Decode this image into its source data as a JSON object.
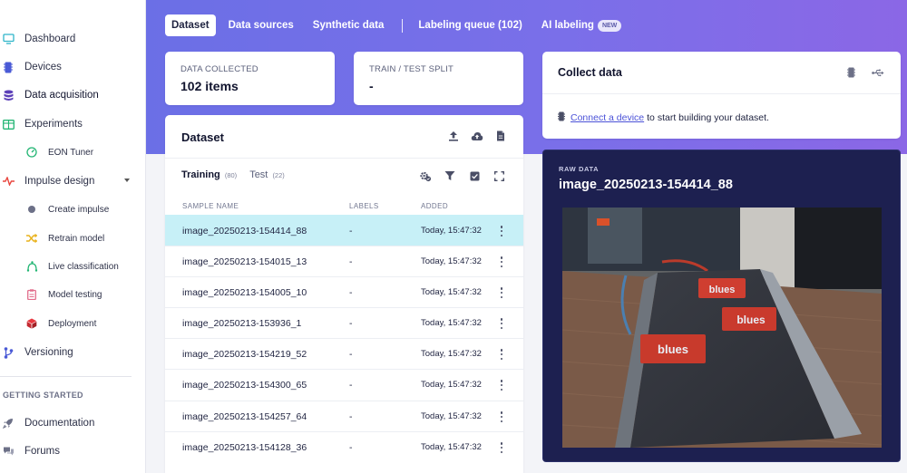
{
  "sidebar": {
    "items": [
      {
        "label": "Dashboard",
        "icon": "monitor-icon"
      },
      {
        "label": "Devices",
        "icon": "device-icon"
      },
      {
        "label": "Data acquisition",
        "icon": "database-icon"
      },
      {
        "label": "Experiments",
        "icon": "table-icon"
      },
      {
        "label": "EON Tuner",
        "icon": "tuner-icon"
      },
      {
        "label": "Impulse design",
        "icon": "pulse-icon"
      },
      {
        "label": "Create impulse",
        "icon": "dot-icon"
      },
      {
        "label": "Retrain model",
        "icon": "shuffle-icon"
      },
      {
        "label": "Live classification",
        "icon": "radar-icon"
      },
      {
        "label": "Model testing",
        "icon": "clipboard-icon"
      },
      {
        "label": "Deployment",
        "icon": "cube-icon"
      },
      {
        "label": "Versioning",
        "icon": "branch-icon"
      }
    ],
    "section_title": "GETTING STARTED",
    "getting_started": [
      {
        "label": "Documentation",
        "icon": "rocket-icon"
      },
      {
        "label": "Forums",
        "icon": "chat-icon"
      }
    ]
  },
  "tabs": [
    {
      "label": "Dataset"
    },
    {
      "label": "Data sources"
    },
    {
      "label": "Synthetic data"
    },
    {
      "label": "Labeling queue (102)"
    },
    {
      "label": "AI labeling",
      "badge": "NEW"
    }
  ],
  "stats": {
    "collected_label": "DATA COLLECTED",
    "collected_value": "102 items",
    "split_label": "TRAIN / TEST SPLIT",
    "split_value": "-"
  },
  "dataset": {
    "title": "Dataset",
    "training_label": "Training",
    "training_count": "(80)",
    "test_label": "Test",
    "test_count": "(22)",
    "columns": {
      "name": "SAMPLE NAME",
      "labels": "LABELS",
      "added": "ADDED"
    },
    "rows": [
      {
        "name": "image_20250213-154414_88",
        "labels": "-",
        "added": "Today, 15:47:32"
      },
      {
        "name": "image_20250213-154015_13",
        "labels": "-",
        "added": "Today, 15:47:32"
      },
      {
        "name": "image_20250213-154005_10",
        "labels": "-",
        "added": "Today, 15:47:32"
      },
      {
        "name": "image_20250213-153936_1",
        "labels": "-",
        "added": "Today, 15:47:32"
      },
      {
        "name": "image_20250213-154219_52",
        "labels": "-",
        "added": "Today, 15:47:32"
      },
      {
        "name": "image_20250213-154300_65",
        "labels": "-",
        "added": "Today, 15:47:32"
      },
      {
        "name": "image_20250213-154257_64",
        "labels": "-",
        "added": "Today, 15:47:32"
      },
      {
        "name": "image_20250213-154128_36",
        "labels": "-",
        "added": "Today, 15:47:32"
      }
    ]
  },
  "collect": {
    "title": "Collect data",
    "link_text": "Connect a device",
    "rest_text": "to start building your dataset."
  },
  "raw": {
    "label": "RAW DATA",
    "title": "image_20250213-154414_88",
    "brand_text": "blues"
  },
  "colors": {
    "accent": "#6b6fe6",
    "selected_row": "#c7f0f7",
    "raw_panel": "#1d2050",
    "link": "#4b52d8"
  }
}
